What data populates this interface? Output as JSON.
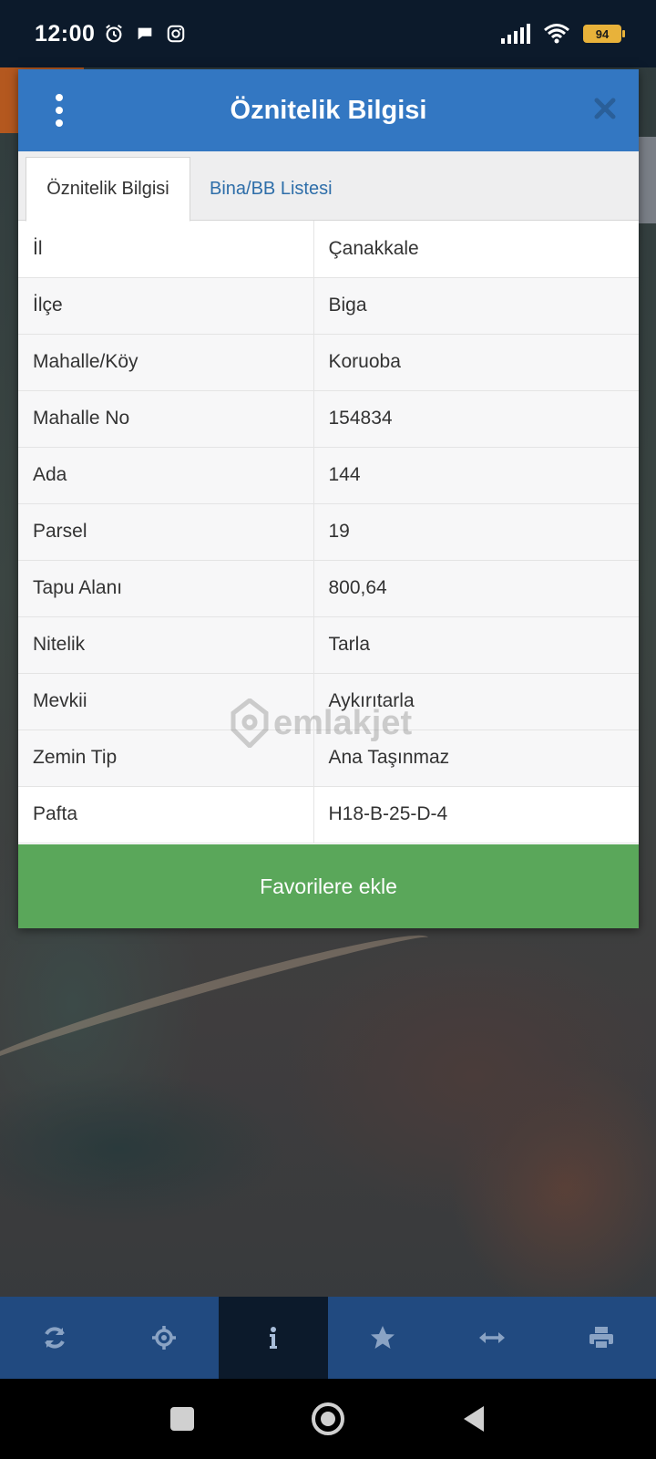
{
  "status_bar": {
    "time": "12:00",
    "battery": "94"
  },
  "dialog": {
    "title": "Öznitelik Bilgisi",
    "tabs": [
      {
        "label": "Öznitelik Bilgisi",
        "active": true
      },
      {
        "label": "Bina/BB Listesi",
        "active": false
      }
    ],
    "rows": [
      {
        "key": "İl",
        "value": "Çanakkale"
      },
      {
        "key": "İlçe",
        "value": "Biga"
      },
      {
        "key": "Mahalle/Köy",
        "value": "Koruoba"
      },
      {
        "key": "Mahalle No",
        "value": "154834"
      },
      {
        "key": "Ada",
        "value": "144"
      },
      {
        "key": "Parsel",
        "value": "19"
      },
      {
        "key": "Tapu Alanı",
        "value": "800,64"
      },
      {
        "key": "Nitelik",
        "value": "Tarla"
      },
      {
        "key": "Mevkii",
        "value": "Aykırıtarla"
      },
      {
        "key": "Zemin Tip",
        "value": "Ana Taşınmaz"
      },
      {
        "key": "Pafta",
        "value": "H18-B-25-D-4"
      }
    ],
    "favorite_button": "Favorilere ekle",
    "watermark": "emlakjet"
  },
  "toolbar": {
    "items": [
      {
        "icon": "refresh-icon"
      },
      {
        "icon": "locate-icon"
      },
      {
        "icon": "info-icon",
        "active": true
      },
      {
        "icon": "star-icon"
      },
      {
        "icon": "measure-icon"
      },
      {
        "icon": "print-icon"
      }
    ]
  },
  "colors": {
    "header": "#3377c2",
    "button": "#5aa75a",
    "toolbar": "#214a80",
    "tab_link": "#2e6ea9"
  }
}
